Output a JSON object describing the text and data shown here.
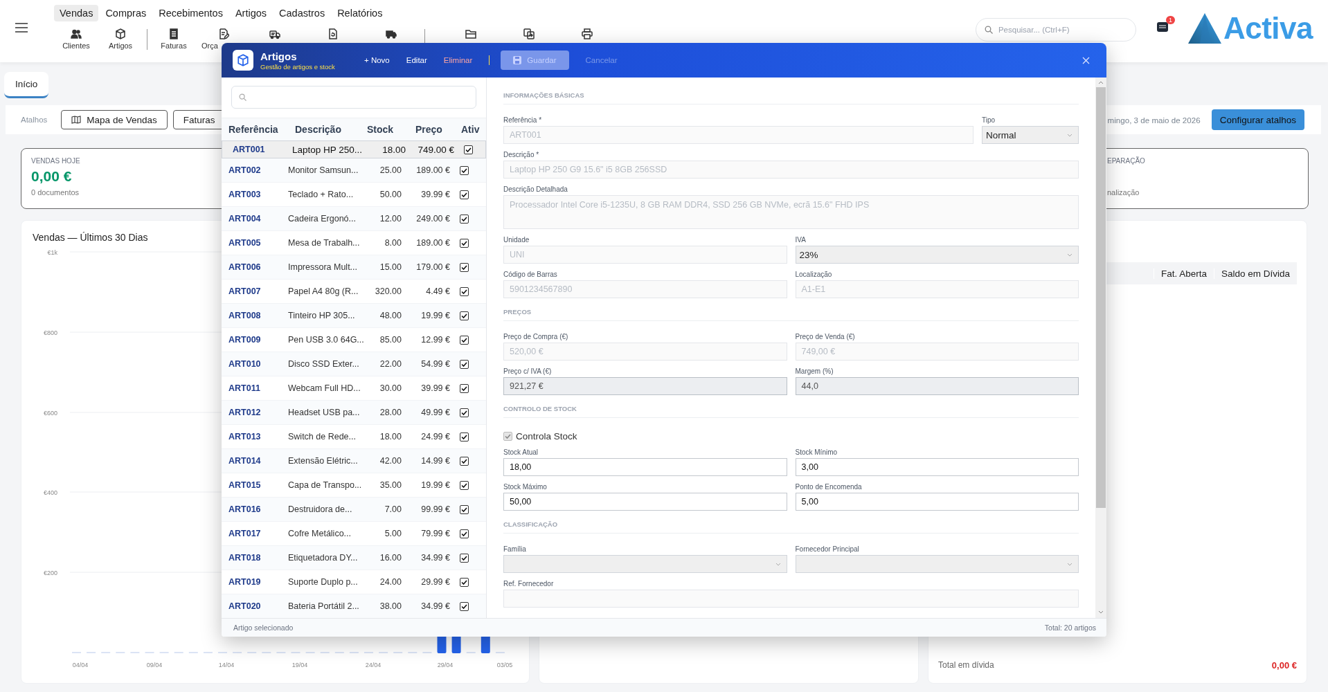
{
  "menu": [
    {
      "label": "Vendas",
      "selected": true
    },
    {
      "label": "Compras",
      "selected": false
    },
    {
      "label": "Recebimentos",
      "selected": false
    },
    {
      "label": "Artigos",
      "selected": false
    },
    {
      "label": "Cadastros",
      "selected": false
    },
    {
      "label": "Relatórios",
      "selected": false
    }
  ],
  "toolbar": [
    {
      "kind": "button",
      "label": "Clientes"
    },
    {
      "kind": "button",
      "label": "Artigos"
    },
    {
      "kind": "separator"
    },
    {
      "kind": "button",
      "label": "Faturas"
    },
    {
      "kind": "button",
      "label": "Orça"
    },
    {
      "kind": "button"
    },
    {
      "kind": "button"
    },
    {
      "kind": "button"
    },
    {
      "kind": "separator"
    },
    {
      "kind": "button"
    },
    {
      "kind": "button"
    },
    {
      "kind": "button"
    }
  ],
  "search": {
    "placeholder": "Pesquisar... (Ctrl+F)"
  },
  "notifications": {
    "badge": "1"
  },
  "logo": {
    "text": "Activa"
  },
  "tabs": [
    {
      "label": "Início",
      "selected": true
    }
  ],
  "shortcuts": {
    "label": "Atalhos",
    "buttons": [
      "Mapa de Vendas",
      "Faturas"
    ],
    "date": "mingo, 3 de maio de 2026",
    "configure": "Configurar atalhos"
  },
  "stats": [
    {
      "label": "VENDAS HOJE",
      "value": "0,00 €",
      "sub": "0 documentos"
    },
    {
      "label": "EPARAÇÃO",
      "sub": "nalização"
    }
  ],
  "sales_chart": {
    "title": "Vendas — Últimos 30 Dias",
    "y_labels": [
      "€1k",
      "€800",
      "€600",
      "€400",
      "€200"
    ],
    "x_labels": [
      "04/04",
      "09/04",
      "14/04",
      "19/04",
      "24/04",
      "29/04",
      "03/05"
    ]
  },
  "debts": {
    "columns": [
      "Fat. Aberta",
      "Saldo em Dívida"
    ],
    "total_label": "Total em dívida",
    "total": "0,00 €"
  },
  "modal": {
    "title": "Artigos",
    "subtitle": "Gestão de artigos e stock",
    "actions": [
      {
        "label": "+ Novo",
        "kind": "link",
        "disabled": false
      },
      {
        "label": "Editar",
        "kind": "link",
        "disabled": false
      },
      {
        "label": "Eliminar",
        "kind": "danger",
        "disabled": false
      },
      {
        "label": "Guardar",
        "kind": "primary",
        "disabled": true
      },
      {
        "label": "Cancelar",
        "kind": "link",
        "disabled": true
      }
    ],
    "list": {
      "columns": [
        "Referência",
        "Descrição",
        "Stock",
        "Preço",
        "Ativ"
      ],
      "rows": [
        {
          "ref": "ART001",
          "description": "Laptop HP 250...",
          "stock": "18.00",
          "price": "749.00 €",
          "active": true,
          "selected": true
        },
        {
          "ref": "ART002",
          "description": "Monitor Samsun...",
          "stock": "25.00",
          "price": "189.00 €",
          "active": true,
          "selected": false
        },
        {
          "ref": "ART003",
          "description": "Teclado + Rato...",
          "stock": "50.00",
          "price": "39.99 €",
          "active": true,
          "selected": false
        },
        {
          "ref": "ART004",
          "description": "Cadeira Ergonó...",
          "stock": "12.00",
          "price": "249.00 €",
          "active": true,
          "selected": false
        },
        {
          "ref": "ART005",
          "description": "Mesa de Trabalh...",
          "stock": "8.00",
          "price": "189.00 €",
          "active": true,
          "selected": false
        },
        {
          "ref": "ART006",
          "description": "Impressora Mult...",
          "stock": "15.00",
          "price": "179.00 €",
          "active": true,
          "selected": false
        },
        {
          "ref": "ART007",
          "description": "Papel A4 80g (R...",
          "stock": "320.00",
          "price": "4.49 €",
          "active": true,
          "selected": false
        },
        {
          "ref": "ART008",
          "description": "Tinteiro HP 305...",
          "stock": "48.00",
          "price": "19.99 €",
          "active": true,
          "selected": false
        },
        {
          "ref": "ART009",
          "description": "Pen USB 3.0 64G...",
          "stock": "85.00",
          "price": "12.99 €",
          "active": true,
          "selected": false
        },
        {
          "ref": "ART010",
          "description": "Disco SSD Exter...",
          "stock": "22.00",
          "price": "54.99 €",
          "active": true,
          "selected": false
        },
        {
          "ref": "ART011",
          "description": "Webcam Full HD...",
          "stock": "30.00",
          "price": "39.99 €",
          "active": true,
          "selected": false
        },
        {
          "ref": "ART012",
          "description": "Headset USB pa...",
          "stock": "28.00",
          "price": "49.99 €",
          "active": true,
          "selected": false
        },
        {
          "ref": "ART013",
          "description": "Switch de Rede...",
          "stock": "18.00",
          "price": "24.99 €",
          "active": true,
          "selected": false
        },
        {
          "ref": "ART014",
          "description": "Extensão Elétric...",
          "stock": "42.00",
          "price": "14.99 €",
          "active": true,
          "selected": false
        },
        {
          "ref": "ART015",
          "description": "Capa de Transpo...",
          "stock": "35.00",
          "price": "19.99 €",
          "active": true,
          "selected": false
        },
        {
          "ref": "ART016",
          "description": "Destruidora de...",
          "stock": "7.00",
          "price": "99.99 €",
          "active": true,
          "selected": false
        },
        {
          "ref": "ART017",
          "description": "Cofre Metálico...",
          "stock": "5.00",
          "price": "79.99 €",
          "active": true,
          "selected": false
        },
        {
          "ref": "ART018",
          "description": "Etiquetadora DY...",
          "stock": "16.00",
          "price": "34.99 €",
          "active": true,
          "selected": false
        },
        {
          "ref": "ART019",
          "description": "Suporte Duplo p...",
          "stock": "24.00",
          "price": "29.99 €",
          "active": true,
          "selected": false
        },
        {
          "ref": "ART020",
          "description": "Bateria Portátil 2...",
          "stock": "38.00",
          "price": "34.99 €",
          "active": true,
          "selected": false
        }
      ]
    },
    "form": [
      {
        "title": "INFORMAÇÕES BÁSICAS",
        "rows": [
          [
            {
              "label": "Referência *",
              "value": "ART001",
              "kind": "input",
              "disabled": true,
              "readonly": false
            },
            {
              "label": "Tipo",
              "value": "Normal",
              "kind": "select"
            }
          ],
          [
            {
              "label": "Descrição *",
              "value": "Laptop HP 250 G9 15.6\" i5 8GB 256SSD",
              "kind": "input",
              "disabled": true,
              "readonly": false
            }
          ],
          [
            {
              "label": "Descrição Detalhada",
              "value": "Processador Intel Core i5-1235U, 8 GB RAM DDR4, SSD 256 GB NVMe, ecrã 15.6\" FHD IPS",
              "kind": "textarea",
              "disabled": true,
              "readonly": false
            }
          ],
          [
            {
              "label": "Unidade",
              "value": "UNI",
              "kind": "input",
              "disabled": true,
              "readonly": false
            },
            {
              "label": "IVA",
              "value": "23%",
              "kind": "select"
            }
          ],
          [
            {
              "label": "Código de Barras",
              "value": "5901234567890",
              "kind": "input",
              "disabled": true,
              "readonly": false
            },
            {
              "label": "Localização",
              "value": "A1-E1",
              "kind": "input",
              "disabled": true,
              "readonly": false
            }
          ]
        ]
      },
      {
        "title": "PREÇOS",
        "rows": [
          [
            {
              "label": "Preço de Compra (€)",
              "value": "520,00 €",
              "kind": "input",
              "disabled": true,
              "readonly": false
            },
            {
              "label": "Preço de Venda (€)",
              "value": "749,00 €",
              "kind": "input",
              "disabled": true,
              "readonly": false
            }
          ],
          [
            {
              "label": "Preço c/ IVA (€)",
              "value": "921,27 €",
              "kind": "input",
              "disabled": false,
              "readonly": true
            },
            {
              "label": "Margem (%)",
              "value": "44,0",
              "kind": "input",
              "disabled": false,
              "readonly": true
            }
          ]
        ]
      },
      {
        "title": "CONTROLO DE STOCK",
        "rows": [
          [
            {
              "label": "Controla Stock",
              "kind": "checkbox",
              "checked": true,
              "disabled": true
            }
          ],
          [
            {
              "label": "Stock Atual",
              "value": "18,00",
              "kind": "input",
              "disabled": false,
              "readonly": false
            },
            {
              "label": "Stock Mínimo",
              "value": "3,00",
              "kind": "input",
              "disabled": false,
              "readonly": false
            }
          ],
          [
            {
              "label": "Stock Máximo",
              "value": "50,00",
              "kind": "input",
              "disabled": false,
              "readonly": false
            },
            {
              "label": "Ponto de Encomenda",
              "value": "5,00",
              "kind": "input",
              "disabled": false,
              "readonly": false
            }
          ]
        ]
      },
      {
        "title": "CLASSIFICAÇÃO",
        "rows": [
          [
            {
              "label": "Família",
              "kind": "select"
            },
            {
              "label": "Fornecedor Principal",
              "kind": "select"
            }
          ],
          [
            {
              "label": "Ref. Fornecedor",
              "kind": "input",
              "disabled": true,
              "readonly": false
            }
          ]
        ]
      }
    ],
    "status_left": "Artigo selecionado",
    "status_right": "Total: 20 artigos"
  }
}
